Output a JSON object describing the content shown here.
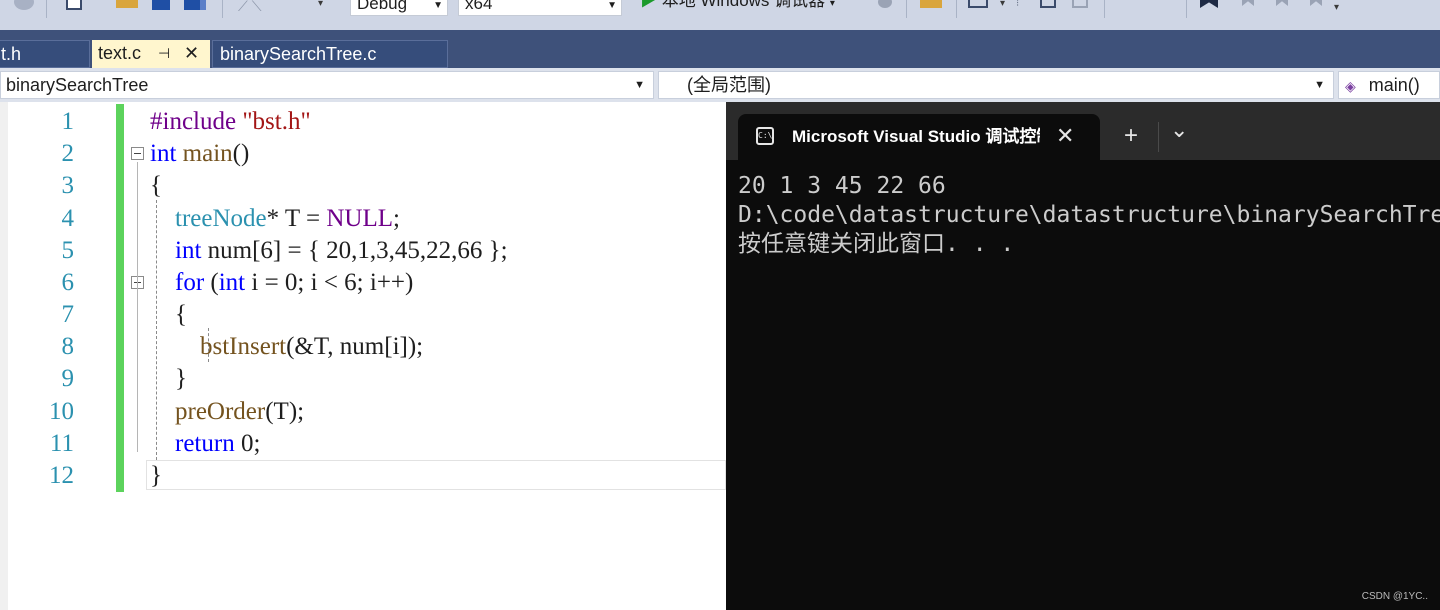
{
  "toolbar": {
    "configuration": "Debug",
    "platform": "x64",
    "debug_target": "本地 Windows 调试器"
  },
  "tabs": [
    {
      "label": "t.h"
    },
    {
      "label": "text.c",
      "pin_icon": "pin-icon",
      "close_icon": "close-icon"
    },
    {
      "label": "binarySearchTree.c"
    }
  ],
  "navbar": {
    "project": "binarySearchTree",
    "scope": "(全局范围)",
    "member": "main()"
  },
  "editor": {
    "line_numbers": [
      "1",
      "2",
      "3",
      "4",
      "5",
      "6",
      "7",
      "8",
      "9",
      "10",
      "11",
      "12"
    ],
    "code": [
      "#include \"bst.h\"",
      "int main()",
      "{",
      "    treeNode* T = NULL;",
      "    int num[6] = { 20,1,3,45,22,66 };",
      "    for (int i = 0; i < 6; i++)",
      "    {",
      "        bstInsert(&T, num[i]);",
      "    }",
      "    preOrder(T);",
      "    return 0;",
      "}"
    ]
  },
  "terminal": {
    "tab_title": "Microsoft Visual Studio 调试控制台",
    "new_tab": "+",
    "dropdown": "⌄",
    "output": [
      "20 1 3 45 22 66",
      "D:\\code\\datastructure\\datastructure\\binarySearchTree",
      "按任意键关闭此窗口. . ."
    ]
  },
  "watermark": "CSDN @1YC.."
}
